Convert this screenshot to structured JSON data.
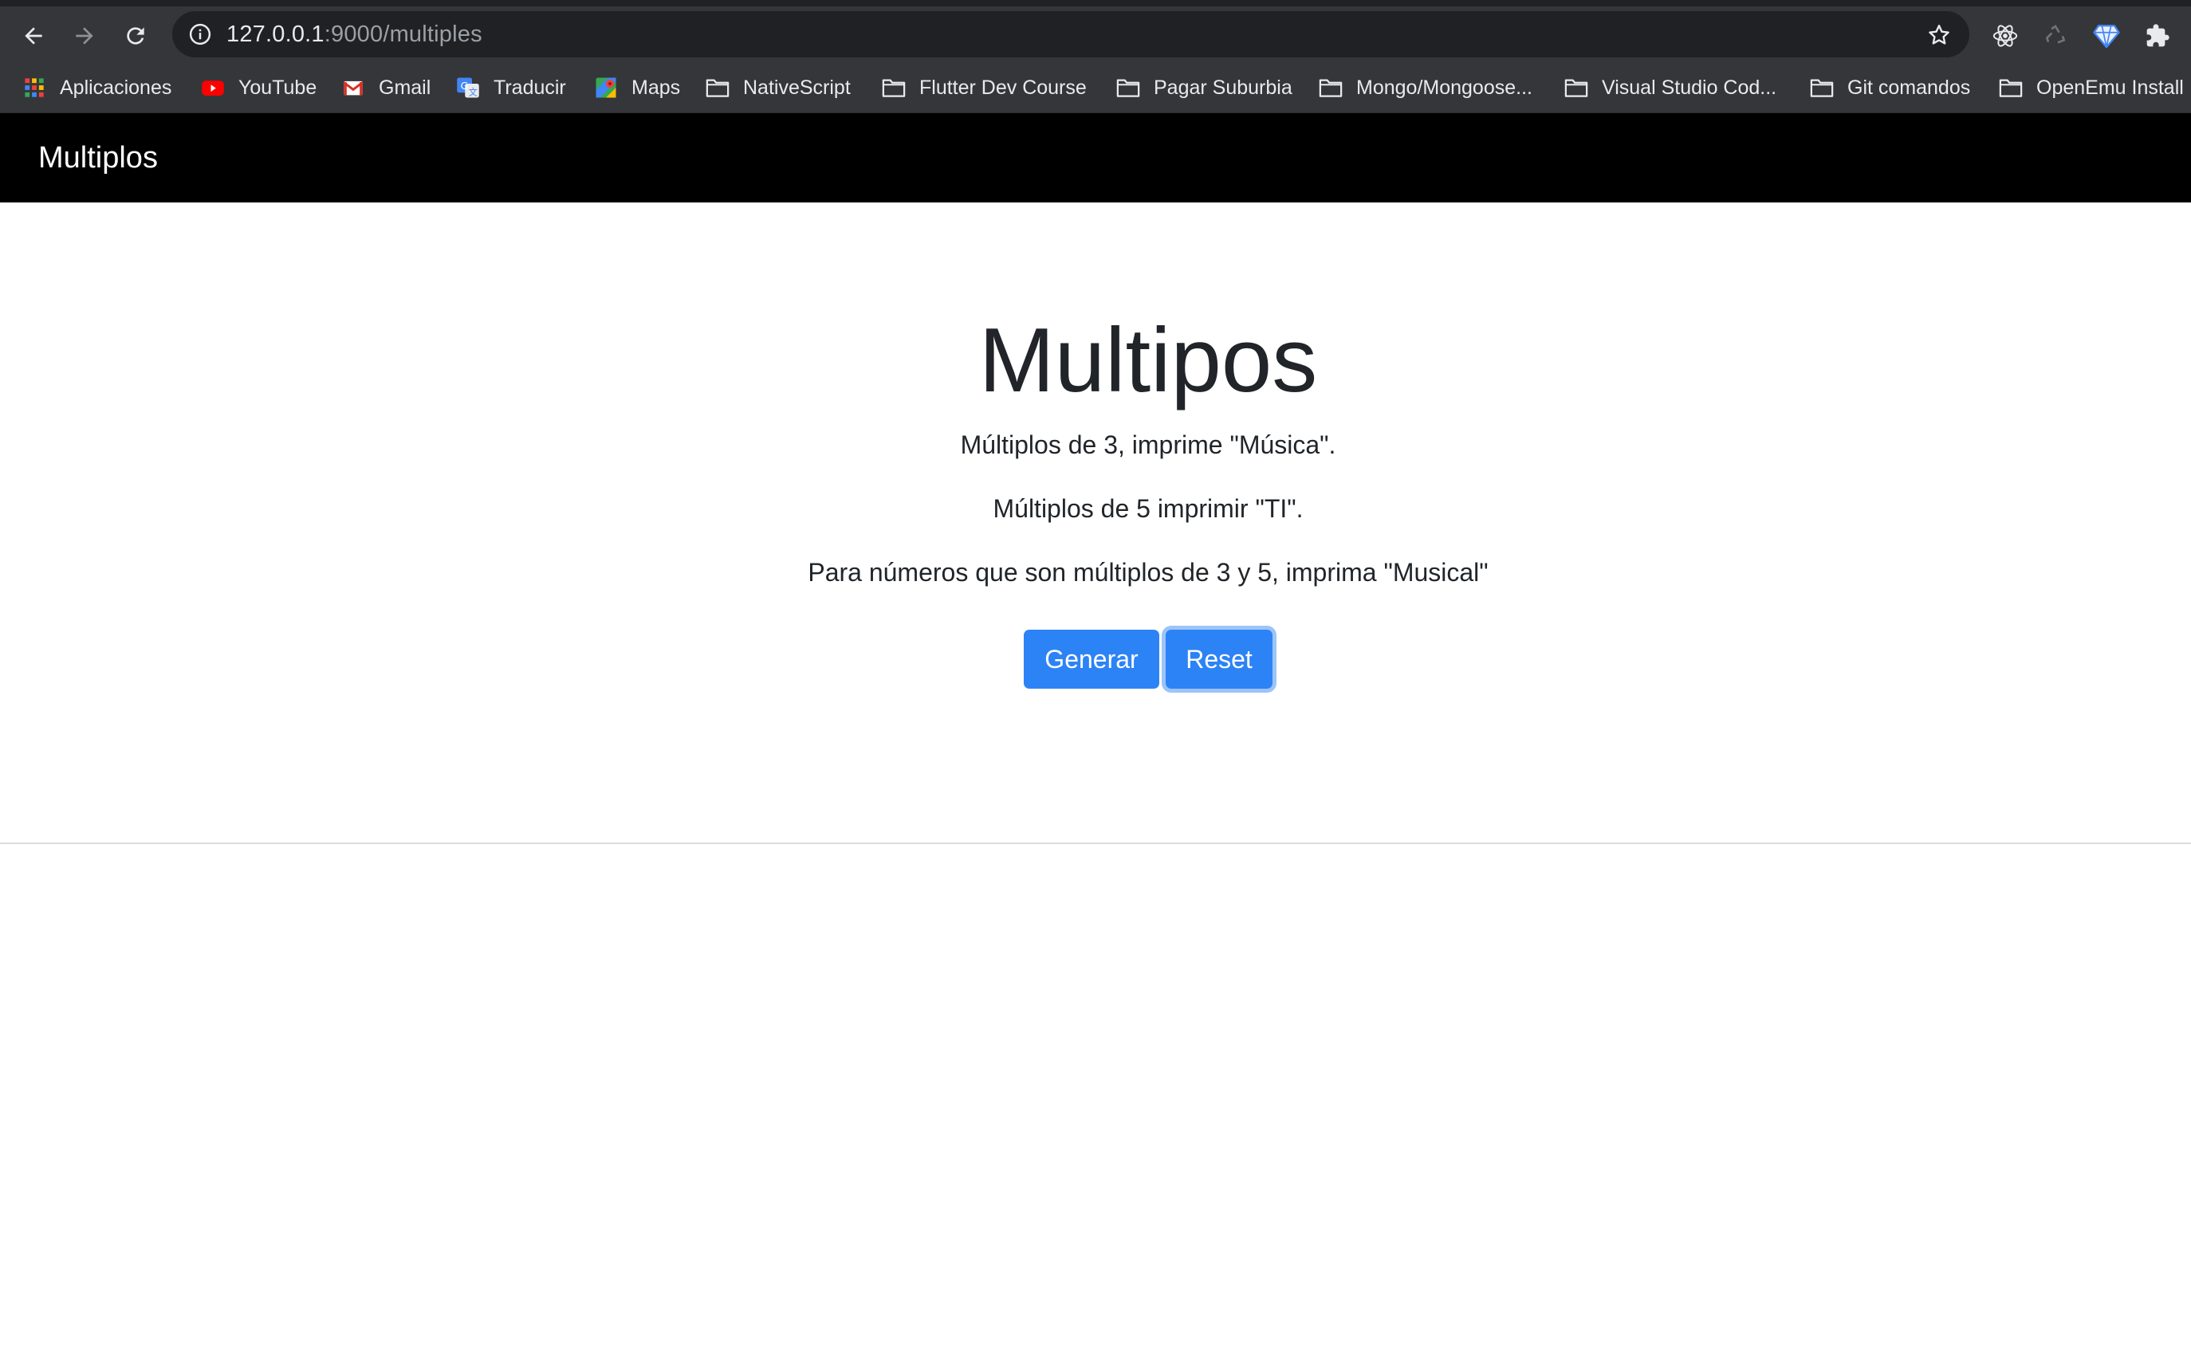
{
  "browser": {
    "url_host": "127.0.0.1",
    "url_rest": ":9000/multiples",
    "bookmarks": [
      {
        "label": "Aplicaciones",
        "icon": "apps-grid-icon"
      },
      {
        "label": "YouTube",
        "icon": "youtube-icon"
      },
      {
        "label": "Gmail",
        "icon": "gmail-icon"
      },
      {
        "label": "Traducir",
        "icon": "translate-icon"
      },
      {
        "label": "Maps",
        "icon": "maps-icon"
      },
      {
        "label": "NativeScript",
        "icon": "folder-icon"
      },
      {
        "label": "Flutter Dev Course",
        "icon": "folder-icon"
      },
      {
        "label": "Pagar Suburbia",
        "icon": "folder-icon"
      },
      {
        "label": "Mongo/Mongoose...",
        "icon": "folder-icon"
      },
      {
        "label": "Visual Studio Cod...",
        "icon": "folder-icon"
      },
      {
        "label": "Git comandos",
        "icon": "folder-icon"
      },
      {
        "label": "OpenEmu Install",
        "icon": "folder-icon"
      }
    ],
    "extensions": [
      "react-devtools-icon",
      "recycle-icon",
      "diamond-icon",
      "puzzle-icon"
    ]
  },
  "navbar": {
    "brand": "Multiplos"
  },
  "main": {
    "title": "Multipos",
    "lines": [
      "Múltiplos de 3, imprime \"Música\".",
      "Múltiplos de 5 imprimir \"TI\".",
      "Para números que son múltiplos de 3 y 5, imprima \"Musical\""
    ],
    "buttons": {
      "generar": "Generar",
      "reset": "Reset"
    }
  },
  "colors": {
    "chrome_bg": "#35363a",
    "omnibox_bg": "#202124",
    "navbar_bg": "#000000",
    "button_primary": "#2c83f6",
    "focus_ring": "#9cc4f8",
    "text": "#212529"
  }
}
